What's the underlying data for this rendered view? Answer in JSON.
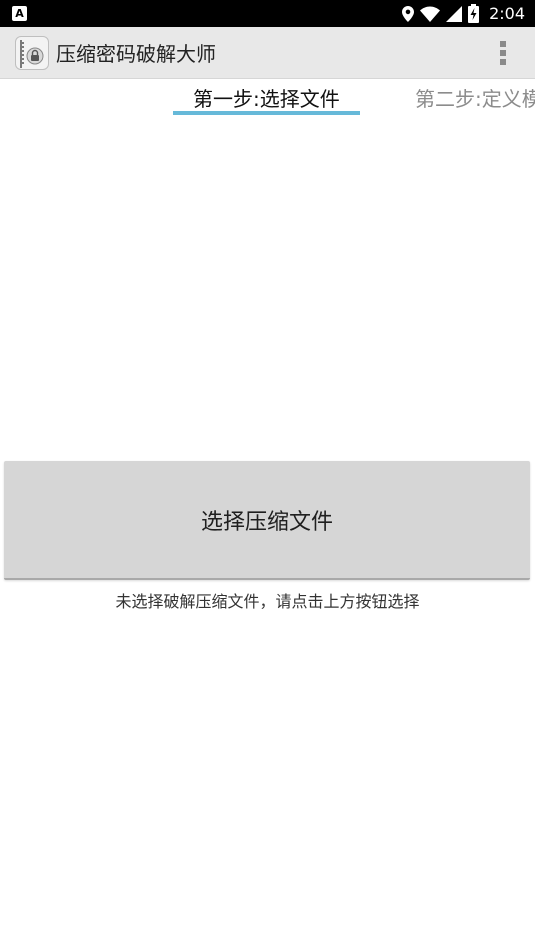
{
  "status_bar": {
    "time": "2:04",
    "icons": [
      "notification-a-icon",
      "location-icon",
      "wifi-icon",
      "signal-icon",
      "battery-charging-icon"
    ]
  },
  "app_bar": {
    "title": "压缩密码破解大师",
    "icon": "zip-lock-app-icon",
    "menu_icon": "overflow-menu-icon"
  },
  "tabs": [
    {
      "label": "第一步:选择文件",
      "selected": true
    },
    {
      "label": "第二步:定义模",
      "selected": false
    }
  ],
  "main": {
    "select_button_label": "选择压缩文件",
    "status_text": "未选择破解压缩文件，请点击上方按钮选择"
  },
  "colors": {
    "status_bar_bg": "#000000",
    "app_bar_bg": "#e8e8e8",
    "tab_indicator": "#66b9d9",
    "button_bg": "#d6d6d6"
  }
}
